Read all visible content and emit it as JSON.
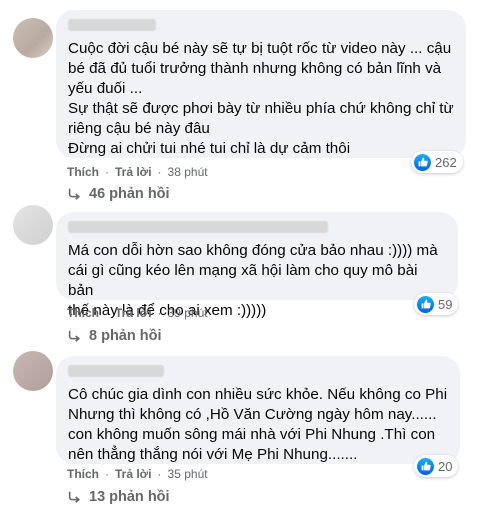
{
  "comments": [
    {
      "author": "",
      "lines": [
        "Cuộc đời cậu bé này sẽ tự bị tuột rốc từ video này ... cậu",
        "bé đã đủ tuổi trưởng thành nhưng không có bản lĩnh và",
        "yếu đuối ...",
        "Sự thật sẽ được phơi bày từ nhiều phía chứ không chỉ từ",
        "riêng cậu bé này đâu",
        "Đừng ai chửi tui nhé tui chỉ là dự cảm thôi"
      ],
      "like_count": "262",
      "like_label": "Thích",
      "reply_label": "Trả lời",
      "time": "38 phút",
      "replies_label": "46 phản hồi"
    },
    {
      "author": "",
      "lines": [
        "Má con dỗi hờn sao không đóng cửa bảo nhau :)))) mà",
        "cái gì cũng kéo lên mạng xã hội làm cho quy mô bài bản",
        "thế này là để cho ai xem :)))))"
      ],
      "like_count": "59",
      "like_label": "Thích",
      "reply_label": "Trả lời",
      "time": "39 phút",
      "replies_label": "8 phản hồi"
    },
    {
      "author": "",
      "lines": [
        "Cô chúc gia dình con nhiều sức khỏe. Nếu không co Phi",
        "Nhưng thì không có ,Hồ Văn Cường ngày hôm nay......",
        "con không muốn sông mái nhà với Phi Nhung .Thì con",
        "nên thẳng thắng nói với Mẹ Phi Nhung......."
      ],
      "like_count": "20",
      "like_label": "Thích",
      "reply_label": "Trả lời",
      "time": "35 phút",
      "replies_label": "13 phản hồi"
    }
  ],
  "icons": {
    "like": "like-icon",
    "reply_arrow": "reply-arrow-icon"
  },
  "colors": {
    "bubble": "#f0f2f5",
    "meta_text": "#65676b",
    "like_blue": "#1877f2"
  }
}
